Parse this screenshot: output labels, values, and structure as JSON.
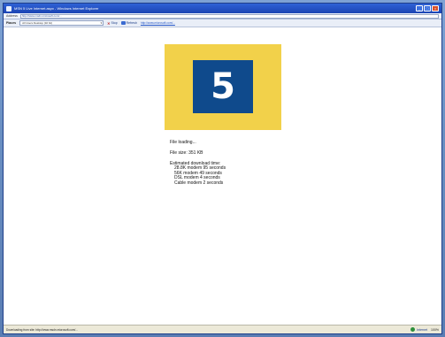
{
  "window": {
    "title": "MSN 5 Live Internet.aspx - Windows Internet Explorer",
    "controls": [
      "minimize",
      "maximize",
      "close"
    ]
  },
  "address": {
    "label": "Address",
    "url": "http://www.msdn.microsoft.com/..."
  },
  "toolbar": {
    "places_label": "Places",
    "places_value": "All Users Desktop (32 bit)",
    "stop_label": "Stop",
    "refresh_label": "Refresh",
    "link_text": "http://www.microsoft.com/..."
  },
  "badge": {
    "number": "5"
  },
  "content": {
    "file_line": "File loading...",
    "size_line": "File size: 351 KB",
    "estimate_heading": "Estimated download time:",
    "estimates": [
      "28.8K modem 95 seconds",
      "56K modem 49 seconds",
      "DSL modem 4 seconds",
      "Cable modem 2 seconds"
    ]
  },
  "status": {
    "text": "Downloading from site: http://www.msdn.microsoft.com/...",
    "zone": "Internet",
    "zoom": "100%"
  },
  "colors": {
    "badge_yellow": "#f2d14a",
    "badge_blue": "#0f4a8c",
    "titlebar": "#1b44b3"
  }
}
